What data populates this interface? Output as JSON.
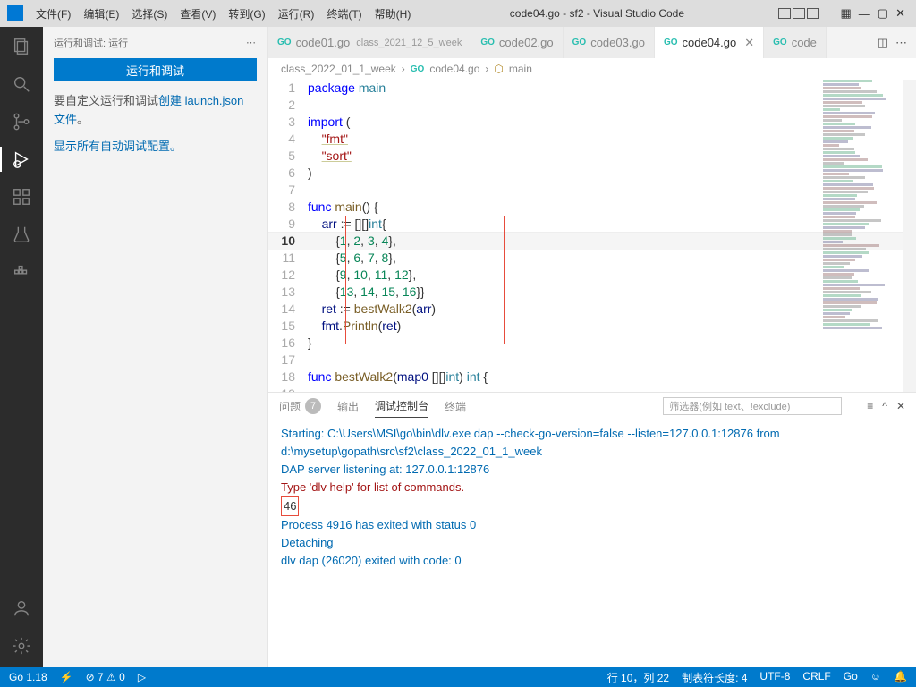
{
  "title": "code04.go - sf2 - Visual Studio Code",
  "menus": [
    "文件(F)",
    "编辑(E)",
    "选择(S)",
    "查看(V)",
    "转到(G)",
    "运行(R)",
    "终端(T)",
    "帮助(H)"
  ],
  "sidebar": {
    "header": "运行和调试: 运行",
    "run_button": "运行和调试",
    "custom_text_pre": "要自定义运行和调试",
    "custom_link": "创建 launch.json 文件",
    "custom_text_post": "。",
    "show_all": "显示所有自动调试配置。"
  },
  "tabs": [
    {
      "label": "code01.go",
      "sub": "class_2021_12_5_week",
      "active": false
    },
    {
      "label": "code02.go",
      "active": false
    },
    {
      "label": "code03.go",
      "active": false
    },
    {
      "label": "code04.go",
      "active": true
    },
    {
      "label": "code",
      "active": false
    }
  ],
  "breadcrumb": {
    "folder": "class_2022_01_1_week",
    "file": "code04.go",
    "symbol": "main"
  },
  "code": {
    "lines": [
      {
        "n": 1,
        "html": "<span class='kw'>package</span> <span class='typ'>main</span>"
      },
      {
        "n": 2,
        "html": ""
      },
      {
        "n": 3,
        "html": "<span class='kw'>import</span> ("
      },
      {
        "n": 4,
        "html": "    <span class='str'>\"fmt\"</span>"
      },
      {
        "n": 5,
        "html": "    <span class='str'>\"sort\"</span>"
      },
      {
        "n": 6,
        "html": ")"
      },
      {
        "n": 7,
        "html": ""
      },
      {
        "n": 8,
        "html": "<span class='kw'>func</span> <span class='fn'>main</span>() {"
      },
      {
        "n": 9,
        "html": "    <span class='var'>arr</span> := [][]<span class='typ'>int</span>{"
      },
      {
        "n": 10,
        "html": "        {<span class='num'>1</span>, <span class='num'>2</span>, <span class='num'>3</span>, <span class='num'>4</span>},",
        "cursor": true
      },
      {
        "n": 11,
        "html": "        {<span class='num'>5</span>, <span class='num'>6</span>, <span class='num'>7</span>, <span class='num'>8</span>},"
      },
      {
        "n": 12,
        "html": "        {<span class='num'>9</span>, <span class='num'>10</span>, <span class='num'>11</span>, <span class='num'>12</span>},"
      },
      {
        "n": 13,
        "html": "        {<span class='num'>13</span>, <span class='num'>14</span>, <span class='num'>15</span>, <span class='num'>16</span>}}"
      },
      {
        "n": 14,
        "html": "    <span class='var'>ret</span> := <span class='fn'>bestWalk2</span>(<span class='var'>arr</span>)"
      },
      {
        "n": 15,
        "html": "    <span class='var'>fmt</span>.<span class='fn'>Println</span>(<span class='var'>ret</span>)"
      },
      {
        "n": 16,
        "html": "}"
      },
      {
        "n": 17,
        "html": ""
      },
      {
        "n": 18,
        "html": "<span class='kw'>func</span> <span class='fn'>bestWalk2</span>(<span class='var'>map0</span> [][]<span class='typ'>int</span>) <span class='typ'>int</span> {"
      },
      {
        "n": 19,
        "html": ""
      }
    ]
  },
  "panel": {
    "tabs": {
      "problems": "问题",
      "problems_count": "7",
      "output": "输出",
      "debug": "调试控制台",
      "terminal": "终端"
    },
    "filter_ph": "筛选器(例如 text、!exclude)",
    "lines": [
      {
        "cls": "blue",
        "text": "Starting: C:\\Users\\MSI\\go\\bin\\dlv.exe dap --check-go-version=false --listen=127.0.0.1:12876 from d:\\mysetup\\gopath\\src\\sf2\\class_2022_01_1_week"
      },
      {
        "cls": "blue",
        "text": "DAP server listening at: 127.0.0.1:12876"
      },
      {
        "cls": "red",
        "text": "Type 'dlv help' for list of commands."
      },
      {
        "cls": "",
        "text": "<span class='box46'>46</span>"
      },
      {
        "cls": "blue",
        "text": "Process 4916 has exited with status 0"
      },
      {
        "cls": "blue",
        "text": "Detaching"
      },
      {
        "cls": "blue",
        "text": "dlv dap (26020) exited with code: 0"
      }
    ]
  },
  "status": {
    "go": "Go 1.18",
    "lightning": "⚡",
    "errors": "⊘ 7 ⚠ 0",
    "lineCol": "行 10，列 22",
    "tabsize": "制表符长度: 4",
    "encoding": "UTF-8",
    "eol": "CRLF",
    "lang": "Go",
    "feedback": "☺",
    "bell": "🔔"
  }
}
